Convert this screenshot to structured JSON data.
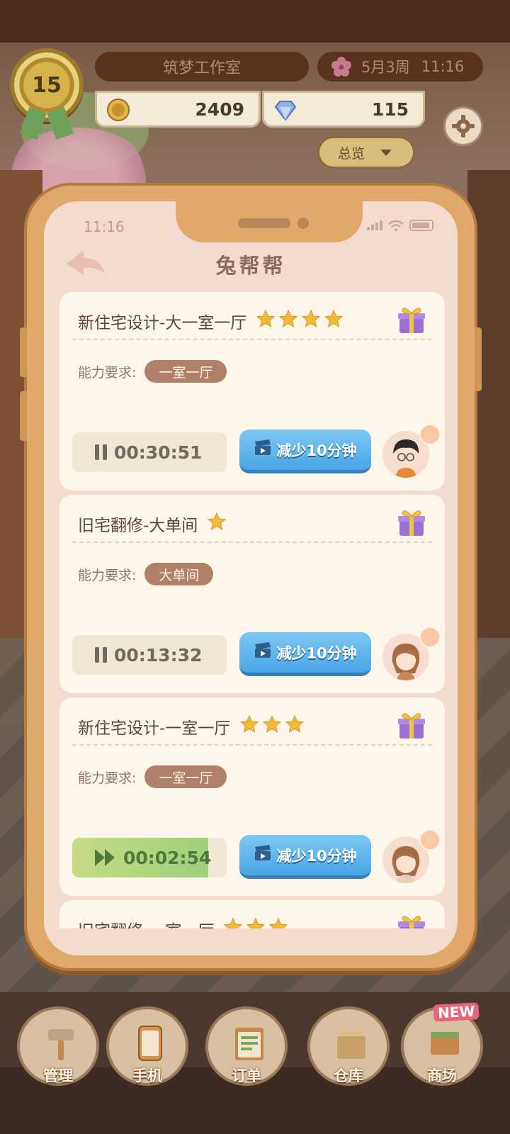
{
  "hud": {
    "level": "15",
    "studio_name": "筑梦工作室",
    "date": "5月3周",
    "time": "11:16",
    "coins": "2409",
    "gems": "115",
    "overview_label": "总览"
  },
  "phone": {
    "status_time": "11:16",
    "app_title": "兔帮帮",
    "requirement_label": "能力要求:",
    "reduce_button_label": "减少10分钟",
    "cards": [
      {
        "title": "新住宅设计-大一室一厅",
        "stars": 4,
        "tag": "一室一厅",
        "timer": "00:30:51",
        "state": "paused",
        "progress": 0
      },
      {
        "title": "旧宅翻修-大单间",
        "stars": 1,
        "tag": "大单间",
        "timer": "00:13:32",
        "state": "paused",
        "progress": 0
      },
      {
        "title": "新住宅设计-一室一厅",
        "stars": 3,
        "tag": "一室一厅",
        "timer": "00:02:54",
        "state": "playing",
        "progress": 0.88
      },
      {
        "title": "旧宅翻修-一室一厅",
        "stars": 3,
        "tag": "",
        "timer": "",
        "state": "partial",
        "progress": 0
      }
    ]
  },
  "nav": {
    "items": [
      {
        "label": "管理",
        "icon": "hammer-icon"
      },
      {
        "label": "手机",
        "icon": "phone-icon"
      },
      {
        "label": "订单",
        "icon": "clipboard-icon"
      },
      {
        "label": "仓库",
        "icon": "box-icon"
      },
      {
        "label": "商场",
        "icon": "cart-icon"
      }
    ],
    "new_badge": "NEW"
  },
  "colors": {
    "accent_blue": "#4aa6e6",
    "tag_brown": "#b08068",
    "star_gold": "#f0b93a",
    "progress_green": "#9fd07a"
  }
}
